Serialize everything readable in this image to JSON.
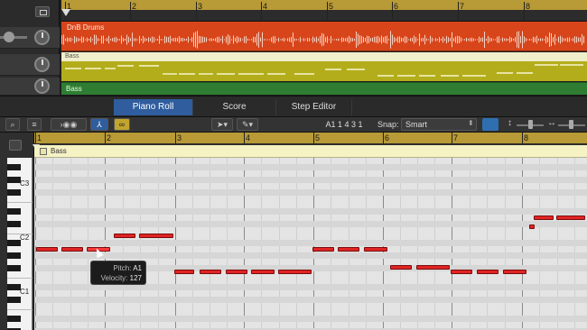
{
  "arrange": {
    "ruler_numbers": [
      "1",
      "2",
      "3",
      "4",
      "5",
      "6",
      "7",
      "8"
    ],
    "drum_region": "DnB Drums",
    "bass_region": "Bass",
    "bass2_region": "Bass"
  },
  "tabs": [
    {
      "label": "Piano Roll",
      "active": true
    },
    {
      "label": "Score",
      "active": false
    },
    {
      "label": "Step Editor",
      "active": false
    }
  ],
  "toolbar": {
    "position": "A1   1 4 3 1",
    "snap_label": "Snap:",
    "snap_value": "Smart"
  },
  "piano_roll": {
    "ruler_numbers": [
      "1",
      "2",
      "3",
      "4",
      "5",
      "6",
      "7",
      "8"
    ],
    "region_label": "Bass",
    "octave_labels": [
      "C3",
      "C2",
      "C1"
    ]
  },
  "tooltip": {
    "pitch_label": "Pitch:",
    "pitch_value": "A1",
    "velocity_label": "Velocity:",
    "velocity_value": "127"
  },
  "colors": {
    "drums": "#d8451a",
    "bass": "#b3ad1b",
    "bass2": "#2e7d32",
    "note": "#e02424",
    "accent": "#2f5d9e"
  }
}
